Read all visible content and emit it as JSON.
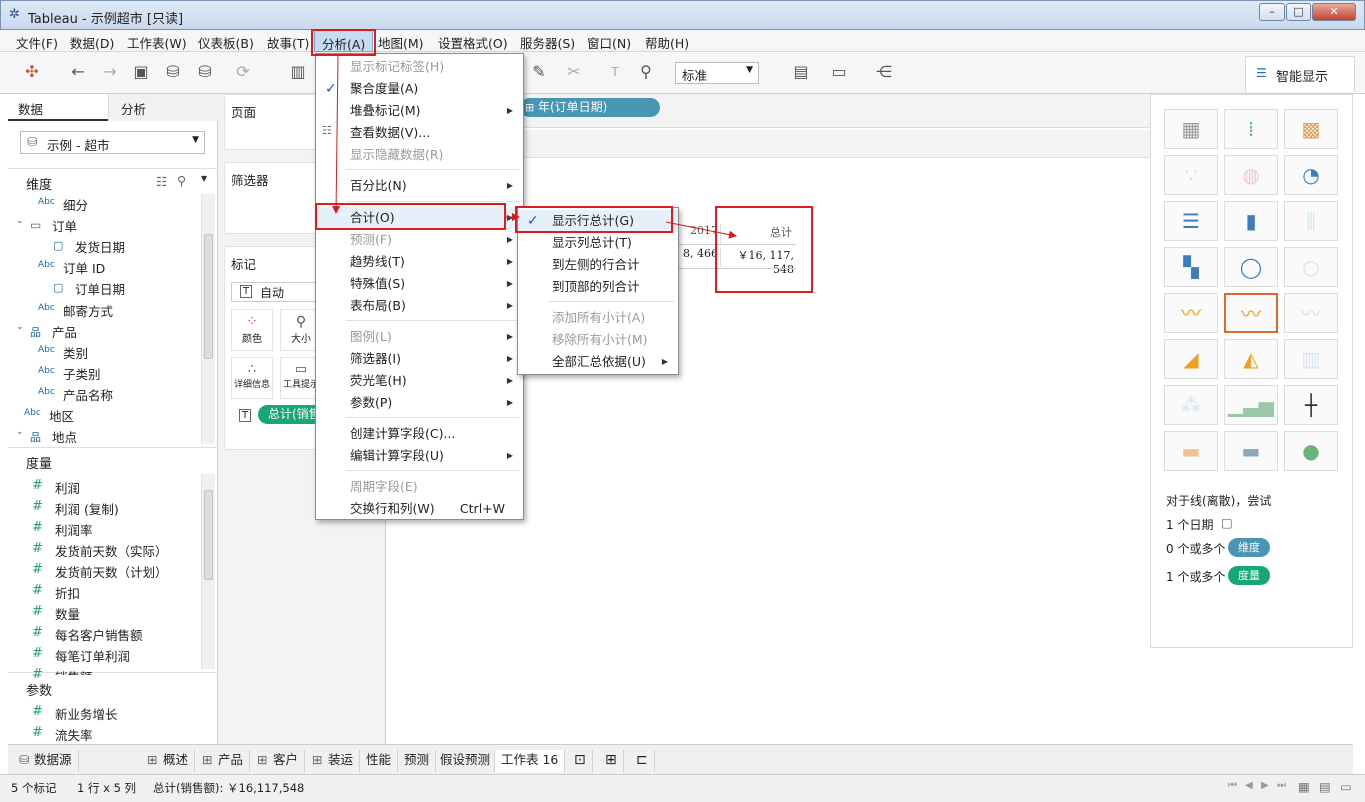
{
  "window": {
    "icon": "tableau-icon",
    "title": "Tableau - 示例超市 [只读]",
    "min": "–",
    "max": "□",
    "close": "✕"
  },
  "menubar": [
    "文件(F)",
    "数据(D)",
    "工作表(W)",
    "仪表板(B)",
    "故事(T)",
    "分析(A)",
    "地图(M)",
    "设置格式(O)",
    "服务器(S)",
    "窗口(N)",
    "帮助(H)"
  ],
  "toolbar": {
    "zoom_value": "标准",
    "smart_show": "智能显示"
  },
  "left": {
    "tab_data": "数据",
    "tab_analysis": "分析",
    "datasource": "示例 - 超市",
    "dimensions_header": "维度",
    "dimensions": [
      {
        "icon": "Abc",
        "label": "细分"
      },
      {
        "icon": "folder",
        "label": "订单"
      },
      {
        "icon": "date",
        "label": "发货日期"
      },
      {
        "icon": "Abc",
        "label": "订单 ID"
      },
      {
        "icon": "date",
        "label": "订单日期"
      },
      {
        "icon": "Abc",
        "label": "邮寄方式"
      },
      {
        "icon": "hierarchy",
        "label": "产品"
      },
      {
        "icon": "Abc",
        "label": "类别"
      },
      {
        "icon": "Abc",
        "label": "子类别"
      },
      {
        "icon": "Abc",
        "label": "产品名称"
      },
      {
        "icon": "Abc",
        "label": "地区"
      },
      {
        "icon": "hierarchy",
        "label": "地点"
      }
    ],
    "measures_header": "度量",
    "measures": [
      "利润",
      "利润 (复制)",
      "利润率",
      "发货前天数（实际）",
      "发货前天数（计划）",
      "折扣",
      "数量",
      "每名客户销售额",
      "每笔订单利润",
      "销售额"
    ],
    "params_header": "参数",
    "params": [
      "新业务增长",
      "流失率"
    ]
  },
  "shelves": {
    "pages": "页面",
    "filters": "筛选器",
    "marks": "标记",
    "mark_type": "自动",
    "color": "颜色",
    "size": "大小",
    "detail": "详细信息",
    "tooltip": "工具提示",
    "measure_pill": "总计(销售"
  },
  "canvas": {
    "column_pill": "年(订单日期)",
    "header_year": "2017",
    "header_total": "总计",
    "cell_year": "8, 466",
    "cell_total": "￥16, 117, 548"
  },
  "smart": {
    "hint": "对于线(离散)，尝试",
    "line1": "1 个日期",
    "line2_prefix": "0 个或多个",
    "dim_pill": "维度",
    "line3_prefix": "1 个或多个",
    "mea_pill": "度量"
  },
  "analysis_menu": [
    {
      "label": "显示标记标签(H)",
      "disabled": true
    },
    {
      "label": "聚合度量(A)",
      "checked": true
    },
    {
      "label": "堆叠标记(M)",
      "sub": true
    },
    {
      "label": "查看数据(V)..."
    },
    {
      "label": "显示隐藏数据(R)",
      "disabled": true
    },
    {
      "label": "百分比(N)",
      "sub": true
    },
    {
      "label": "合计(O)",
      "sub": true
    },
    {
      "label": "预测(F)",
      "sub": true,
      "disabled": true
    },
    {
      "label": "趋势线(T)",
      "sub": true
    },
    {
      "label": "特殊值(S)",
      "sub": true
    },
    {
      "label": "表布局(B)",
      "sub": true
    },
    {
      "label": "图例(L)",
      "sub": true,
      "disabled": true
    },
    {
      "label": "筛选器(I)",
      "sub": true
    },
    {
      "label": "荧光笔(H)",
      "sub": true
    },
    {
      "label": "参数(P)",
      "sub": true
    },
    {
      "label": "创建计算字段(C)..."
    },
    {
      "label": "编辑计算字段(U)",
      "sub": true
    },
    {
      "label": "周期字段(E)",
      "disabled": true
    },
    {
      "label": "交换行和列(W)",
      "shortcut": "Ctrl+W"
    }
  ],
  "totals_menu": [
    {
      "label": "显示行总计(G)",
      "checked": true
    },
    {
      "label": "显示列总计(T)"
    },
    {
      "label": "到左侧的行合计"
    },
    {
      "label": "到顶部的列合计"
    },
    {
      "label": "添加所有小计(A)",
      "disabled": true
    },
    {
      "label": "移除所有小计(M)",
      "disabled": true
    },
    {
      "label": "全部汇总依据(U)",
      "sub": true
    }
  ],
  "tabs": [
    "数据源",
    "概述",
    "产品",
    "客户",
    "装运",
    "性能",
    "预测",
    "假设预测",
    "工作表 16"
  ],
  "status": {
    "marks": "5 个标记",
    "rows": "1 行 x 5 列",
    "sum": "总计(销售额): ￥16,117,548"
  }
}
